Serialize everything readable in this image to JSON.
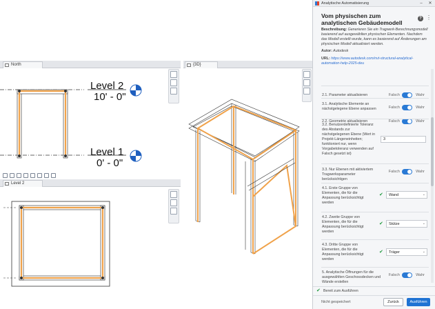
{
  "views": {
    "elevation_tab": "North",
    "view3d_tab": "{3D}",
    "plan_tab": "Level 2",
    "levels": [
      {
        "name": "Level 2",
        "elevation": "10' - 0\""
      },
      {
        "name": "Level 1",
        "elevation": "0' - 0\""
      }
    ]
  },
  "dialog": {
    "window_title": "Analytische Automatisierung",
    "heading": "Vom physischen zum analytischen Gebäudemodell",
    "description_label": "Beschreibung:",
    "description": "Generieren Sie ein Tragwerk-Berechnungsmodell basierend auf ausgewählten physischen Elementen. Nachdem das Modell erstellt wurde, kann es basierend auf Änderungen am physischen Modell aktualisiert werden.",
    "author_label": "Autor:",
    "author": "Autodesk",
    "url_label": "URL:",
    "url": "https://www.autodesk.com/nvt-structural-analytical-automation-help-2025-deu",
    "toggle_off": "Falsch",
    "toggle_on": "Wahr",
    "params": [
      {
        "label": "2.1. Parameter aktualisieren",
        "kind": "toggle",
        "value": true
      },
      {
        "label": "2.2. Geometrie aktualisieren",
        "kind": "toggle",
        "value": true
      },
      {
        "label": "3.1. Analytische Elemente an nächstgelegene Ebene anpassen",
        "kind": "toggle",
        "value": true
      },
      {
        "label": "3.2. Benutzerdefinierte Toleranz des Abstands zur nächstgelegenen Ebene (Wert in Projekt-Längeneinheiten; funktioniert nur, wenn Vorgabetoleranz verwenden auf Falsch gesetzt ist)",
        "kind": "number",
        "value": "3"
      },
      {
        "label": "3.3. Nur Ebenen mit aktiviertem Tragwerksparameter berücksichtigen",
        "kind": "toggle",
        "value": true
      },
      {
        "label": "4.1. Erste Gruppe von Elementen, die für die Anpassung berücksichtigt werden",
        "kind": "select",
        "value": "Wand"
      },
      {
        "label": "4.2. Zweite Gruppe von Elementen, die für die Anpassung berücksichtigt werden",
        "kind": "select",
        "value": "Stütze"
      },
      {
        "label": "4.3. Dritte Gruppe von Elementen, die für die Anpassung berücksichtigt werden",
        "kind": "select",
        "value": "Träger"
      },
      {
        "label": "5. Analytische Öffnungen für die ausgewählten Geschossdecken und Wände erstellen",
        "kind": "toggle",
        "value": true
      }
    ],
    "status": "Bereit zum Ausführen",
    "saved_state": "Nicht gespeichert",
    "cancel_label": "Zurück",
    "run_label": "Ausführen"
  },
  "colors": {
    "accent": "#1f73d3",
    "beam_orange": "#f0a24a",
    "ok_green": "#1f9a3e"
  }
}
